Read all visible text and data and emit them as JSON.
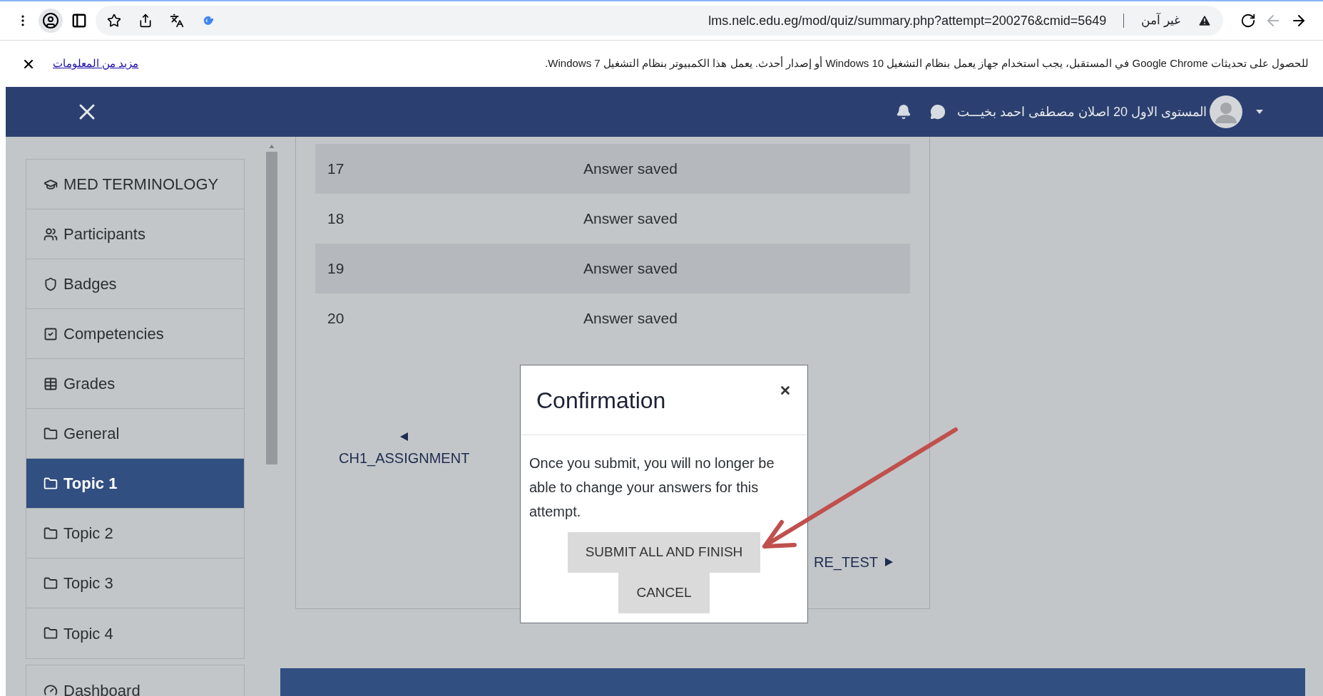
{
  "browser": {
    "url": "lms.nelc.edu.eg/mod/quiz/summary.php?attempt=200276&cmid=5649",
    "security_label": "غير آمن"
  },
  "infobar": {
    "message": "للحصول على تحديثات Google Chrome في المستقبل، يجب استخدام جهاز يعمل بنظام التشغيل Windows 10 أو إصدار أحدث. يعمل هذا الكمبيوتر بنظام التشغيل Windows 7.",
    "link": "مزيد من المعلومات"
  },
  "header": {
    "user_name": "المستوى الاول 20 اصلان مصطفى احمد بخيـــت"
  },
  "sidebar": {
    "sections": [
      {
        "items": [
          {
            "label": "MED TERMINOLOGY",
            "kind": "course",
            "selected": false
          },
          {
            "label": "Participants",
            "kind": "people",
            "selected": false
          },
          {
            "label": "Badges",
            "kind": "badge",
            "selected": false
          },
          {
            "label": "Competencies",
            "kind": "check",
            "selected": false
          },
          {
            "label": "Grades",
            "kind": "table",
            "selected": false
          },
          {
            "label": "General",
            "kind": "folder",
            "selected": false
          },
          {
            "label": "Topic 1",
            "kind": "folder",
            "selected": true
          },
          {
            "label": "Topic 2",
            "kind": "folder",
            "selected": false
          },
          {
            "label": "Topic 3",
            "kind": "folder",
            "selected": false
          },
          {
            "label": "Topic 4",
            "kind": "folder",
            "selected": false
          }
        ]
      },
      {
        "items": [
          {
            "label": "Dashboard",
            "kind": "dashboard",
            "selected": false
          }
        ]
      }
    ]
  },
  "summary_rows": [
    {
      "question": "17",
      "status": "Answer saved"
    },
    {
      "question": "18",
      "status": "Answer saved"
    },
    {
      "question": "19",
      "status": "Answer saved"
    },
    {
      "question": "20",
      "status": "Answer saved"
    }
  ],
  "navigation": {
    "previous": "CH1_ASSIGNMENT",
    "next": "RE_TEST"
  },
  "dialog": {
    "title": "Confirmation",
    "message": "Once you submit, you will no longer be able to change your answers for this attempt.",
    "buttons": [
      "SUBMIT ALL AND FINISH",
      "CANCEL"
    ]
  }
}
